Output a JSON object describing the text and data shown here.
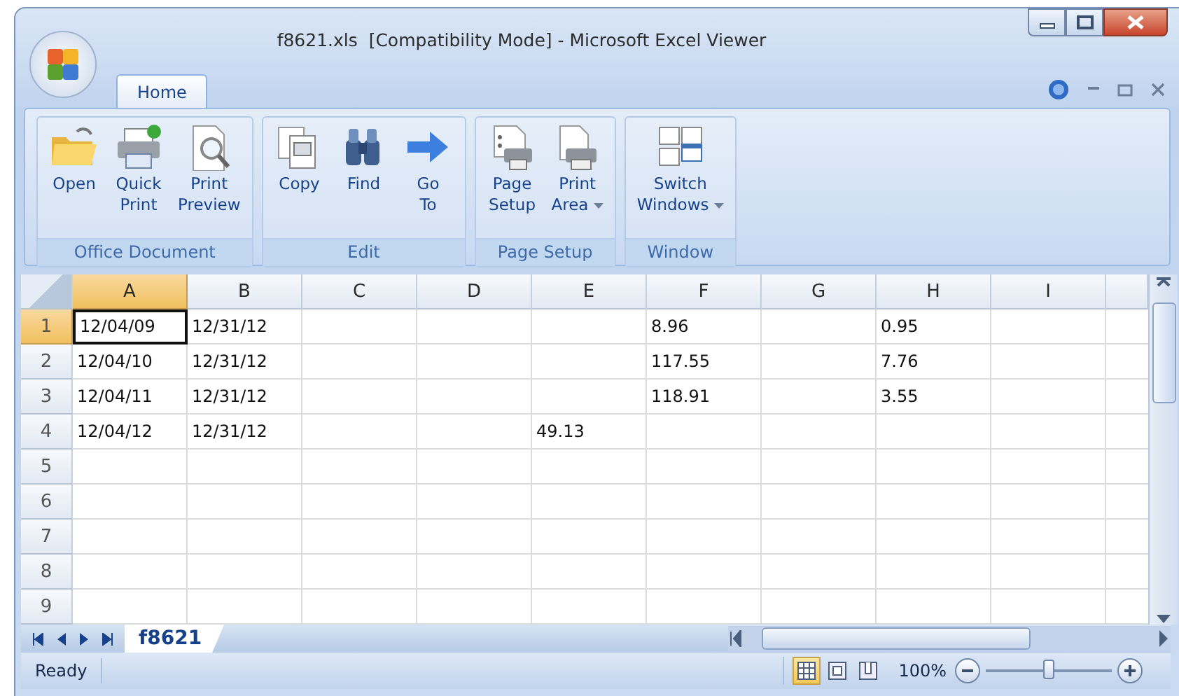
{
  "window": {
    "title": "f8621.xls  [Compatibility Mode] - Microsoft Excel Viewer"
  },
  "tabs": [
    {
      "label": "Home",
      "selected": true
    }
  ],
  "ribbon": {
    "groups": [
      {
        "label": "Office Document",
        "buttons": [
          {
            "label": "Open",
            "kind": "open",
            "dropdown": false
          },
          {
            "label": "Quick\nPrint",
            "kind": "print",
            "dropdown": false
          },
          {
            "label": "Print\nPreview",
            "kind": "preview",
            "dropdown": false
          }
        ]
      },
      {
        "label": "Edit",
        "buttons": [
          {
            "label": "Copy",
            "kind": "copy",
            "dropdown": false
          },
          {
            "label": "Find",
            "kind": "find",
            "dropdown": false
          },
          {
            "label": "Go\nTo",
            "kind": "goto",
            "dropdown": false
          }
        ]
      },
      {
        "label": "Page Setup",
        "buttons": [
          {
            "label": "Page\nSetup",
            "kind": "pagesetup",
            "dropdown": false
          },
          {
            "label": "Print\nArea",
            "kind": "printarea",
            "dropdown": true
          }
        ]
      },
      {
        "label": "Window",
        "buttons": [
          {
            "label": "Switch\nWindows",
            "kind": "switch",
            "dropdown": true
          }
        ]
      }
    ]
  },
  "sheet": {
    "columns": [
      {
        "label": "A",
        "selected": true
      },
      {
        "label": "B",
        "selected": false
      },
      {
        "label": "C",
        "selected": false
      },
      {
        "label": "D",
        "selected": false
      },
      {
        "label": "E",
        "selected": false
      },
      {
        "label": "F",
        "selected": false
      },
      {
        "label": "G",
        "selected": false
      },
      {
        "label": "H",
        "selected": false
      },
      {
        "label": "I",
        "selected": false
      }
    ],
    "rows": [
      {
        "label": "1",
        "selected": true,
        "cells": [
          "12/04/09",
          "12/31/12",
          null,
          null,
          null,
          "8.96",
          null,
          "0.95",
          null
        ]
      },
      {
        "label": "2",
        "selected": false,
        "cells": [
          "12/04/10",
          "12/31/12",
          null,
          null,
          null,
          "117.55",
          null,
          "7.76",
          null
        ]
      },
      {
        "label": "3",
        "selected": false,
        "cells": [
          "12/04/11",
          "12/31/12",
          null,
          null,
          null,
          "118.91",
          null,
          "3.55",
          null
        ]
      },
      {
        "label": "4",
        "selected": false,
        "cells": [
          "12/04/12",
          "12/31/12",
          null,
          null,
          "49.13",
          null,
          null,
          null,
          null
        ]
      },
      {
        "label": "5",
        "selected": false,
        "cells": [
          null,
          null,
          null,
          null,
          null,
          null,
          null,
          null,
          null
        ]
      },
      {
        "label": "6",
        "selected": false,
        "cells": [
          null,
          null,
          null,
          null,
          null,
          null,
          null,
          null,
          null
        ]
      },
      {
        "label": "7",
        "selected": false,
        "cells": [
          null,
          null,
          null,
          null,
          null,
          null,
          null,
          null,
          null
        ]
      },
      {
        "label": "8",
        "selected": false,
        "cells": [
          null,
          null,
          null,
          null,
          null,
          null,
          null,
          null,
          null
        ]
      },
      {
        "label": "9",
        "selected": false,
        "cells": [
          null,
          null,
          null,
          null,
          null,
          null,
          null,
          null,
          null
        ]
      }
    ],
    "sheet_tabs": [
      {
        "label": "f8621",
        "selected": true
      }
    ]
  },
  "status_bar": {
    "status": "Ready",
    "views": [
      {
        "kind": "normal",
        "selected": true
      },
      {
        "kind": "layout",
        "selected": false
      },
      {
        "kind": "pagebreak",
        "selected": false
      }
    ],
    "zoom": "100%",
    "zoom_slider": {
      "level": 0.5
    }
  }
}
